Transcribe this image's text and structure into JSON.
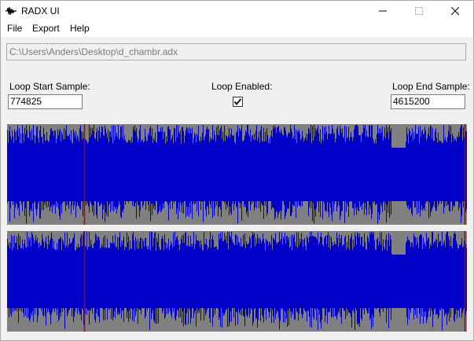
{
  "window": {
    "title": "RADX UI",
    "minimize_icon": "minimize-icon",
    "maximize_icon": "maximize-icon",
    "close_icon": "close-icon"
  },
  "menu": {
    "items": [
      {
        "label": "File"
      },
      {
        "label": "Export"
      },
      {
        "label": "Help"
      }
    ]
  },
  "file_path": "C:\\Users\\Anders\\Desktop\\d_chambr.adx",
  "loop": {
    "start_label": "Loop Start Sample:",
    "start_value": "774825",
    "enabled_label": "Loop Enabled:",
    "enabled": true,
    "end_label": "Loop End Sample:",
    "end_value": "4615200"
  },
  "waveform": {
    "channels": 2,
    "background_color": "#808080",
    "wave_color": "#0000c8",
    "marker_color": "#b00000",
    "loop_start_fraction": 0.168,
    "loop_end_fraction": 0.995
  }
}
